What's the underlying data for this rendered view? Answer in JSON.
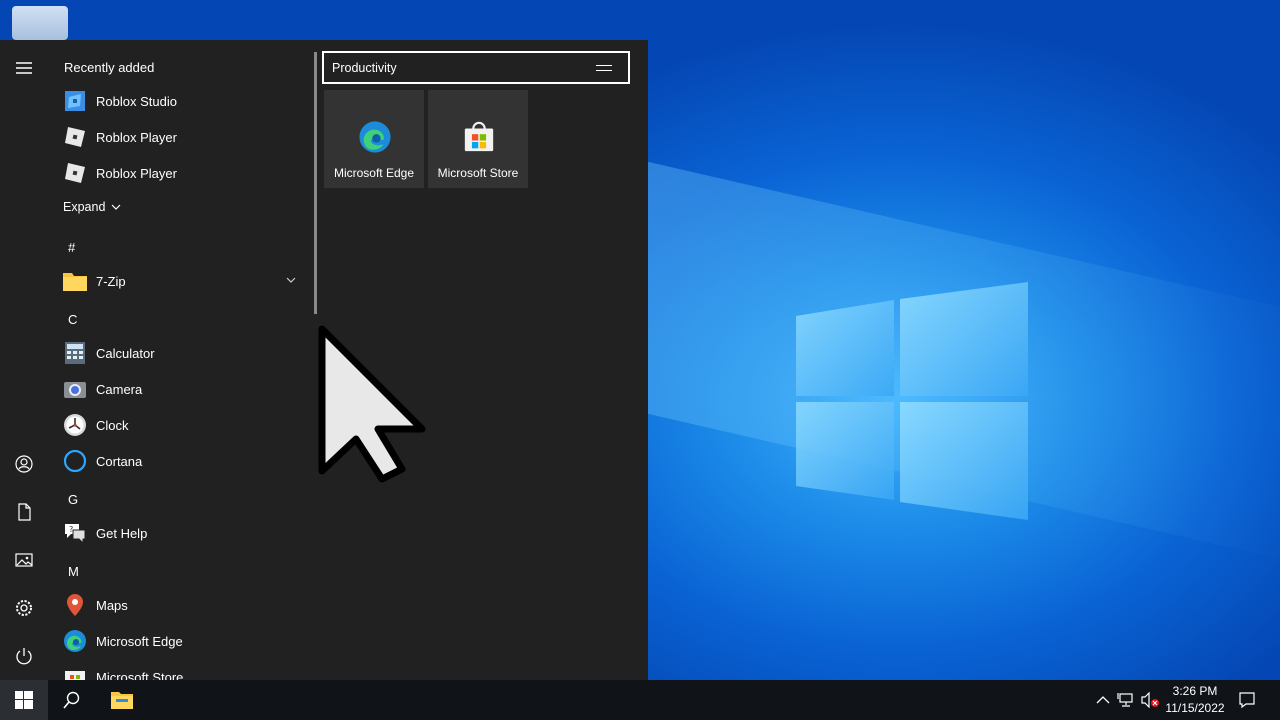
{
  "start_menu": {
    "recently_added_label": "Recently added",
    "recent_apps": [
      {
        "label": "Roblox Studio",
        "icon": "roblox-studio-icon"
      },
      {
        "label": "Roblox Player",
        "icon": "roblox-player-icon"
      },
      {
        "label": "Roblox Player",
        "icon": "roblox-player-icon"
      }
    ],
    "expand_label": "Expand",
    "letters": [
      "#",
      "C",
      "G",
      "M"
    ],
    "apps": {
      "seven_zip": "7-Zip",
      "calculator": "Calculator",
      "camera": "Camera",
      "clock": "Clock",
      "cortana": "Cortana",
      "get_help": "Get Help",
      "maps": "Maps",
      "edge": "Microsoft Edge",
      "store": "Microsoft Store"
    },
    "rail_icons": [
      "hamburger-icon",
      "user-icon",
      "documents-icon",
      "pictures-icon",
      "settings-icon",
      "power-icon"
    ],
    "tile_group": {
      "title": "Productivity",
      "tiles": [
        {
          "label": "Microsoft Edge",
          "icon": "edge-icon"
        },
        {
          "label": "Microsoft Store",
          "icon": "store-icon"
        }
      ]
    }
  },
  "taskbar": {
    "time": "3:26 PM",
    "date": "11/15/2022",
    "tray_icons": [
      "chevron-up-icon",
      "network-icon",
      "volume-muted-icon",
      "notification-icon"
    ],
    "pinned": [
      "start-icon",
      "search-icon",
      "file-explorer-icon"
    ]
  },
  "colors": {
    "menu_bg": "#212121",
    "tile_bg": "#333333",
    "taskbar_bg": "#101418",
    "wallpaper_blue": "#0a63d4"
  }
}
